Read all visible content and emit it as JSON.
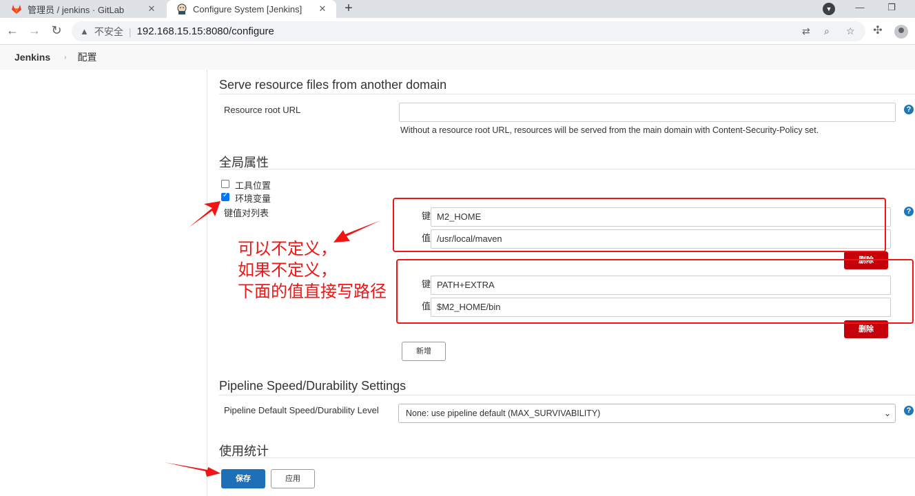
{
  "browser": {
    "tabs": [
      {
        "title": "管理员 / jenkins · GitLab",
        "active": false,
        "icon": "gitlab-icon"
      },
      {
        "title": "Configure System [Jenkins]",
        "active": true,
        "icon": "jenkins-icon"
      }
    ],
    "new_tab_label": "+",
    "omnibox": {
      "security_label": "不安全",
      "url": "192.168.15.15:8080/configure"
    }
  },
  "breadcrumbs": {
    "root": "Jenkins",
    "current": "配置"
  },
  "resource_domain": {
    "title": "Serve resource files from another domain",
    "root_url_label": "Resource root URL",
    "root_url_value": "",
    "description": "Without a resource root URL, resources will be served from the main domain with Content-Security-Policy set."
  },
  "global_properties": {
    "title": "全局属性",
    "tool_locations_label": "工具位置",
    "tool_locations_checked": false,
    "env_vars_label": "环境变量",
    "env_vars_checked": true,
    "kv_list_label": "键值对列表",
    "entries": [
      {
        "key_label": "键",
        "key": "M2_HOME",
        "value_label": "值",
        "value": "/usr/local/maven",
        "delete_label": "删除"
      },
      {
        "key_label": "键",
        "key": "PATH+EXTRA",
        "value_label": "值",
        "value": "$M2_HOME/bin",
        "delete_label": "删除"
      }
    ],
    "add_label": "新增"
  },
  "pipeline": {
    "title": "Pipeline Speed/Durability Settings",
    "level_label": "Pipeline Default Speed/Durability Level",
    "level_value": "None: use pipeline default (MAX_SURVIVABILITY)"
  },
  "usage": {
    "title": "使用统计"
  },
  "actions": {
    "save_label": "保存",
    "apply_label": "应用"
  },
  "annotation": {
    "text": "可以不定义，\n如果不定义，\n下面的值直接写路径",
    "color": "#f01414"
  },
  "colors": {
    "help": "#1f77b4",
    "delete": "#c4000a",
    "save": "#1d6fb8"
  }
}
